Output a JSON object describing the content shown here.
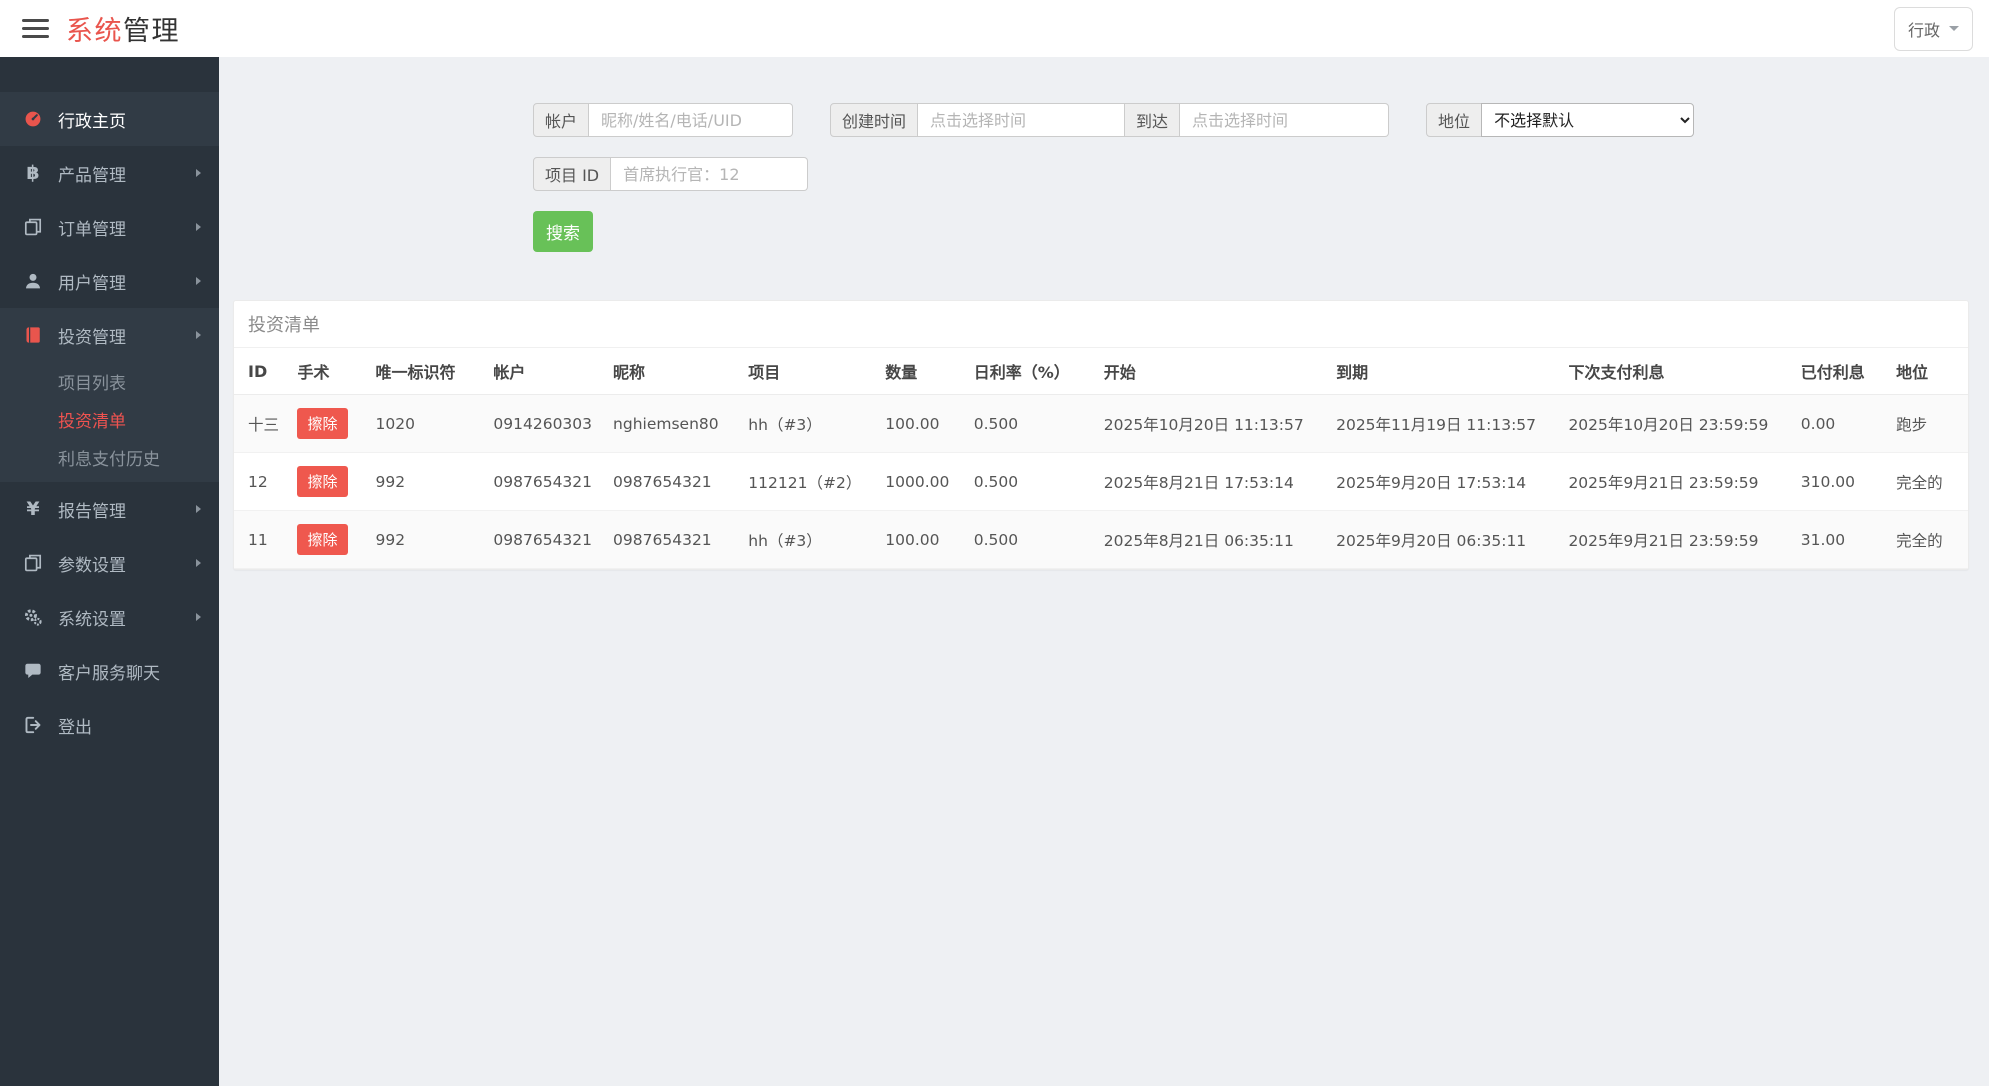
{
  "header": {
    "brand_red": "系统",
    "brand_dark": "管理",
    "user_menu_label": "行政"
  },
  "sidebar": {
    "items": [
      {
        "name": "admin-home",
        "label": "行政主页",
        "icon": "dashboard-icon",
        "icon_accent": true,
        "active": true
      },
      {
        "name": "product-management",
        "label": "产品管理",
        "icon": "bitcoin-icon",
        "chevron": true
      },
      {
        "name": "order-management",
        "label": "订单管理",
        "icon": "orders-icon",
        "chevron": true
      },
      {
        "name": "user-management",
        "label": "用户管理",
        "icon": "users-icon",
        "chevron": true
      },
      {
        "name": "investment-management",
        "label": "投资管理",
        "icon": "book-icon",
        "icon_accent": true,
        "chevron": true,
        "expanded": true,
        "children": [
          {
            "name": "project-list",
            "label": "项目列表"
          },
          {
            "name": "investment-list",
            "label": "投资清单",
            "active": true
          },
          {
            "name": "interest-payment-history",
            "label": "利息支付历史"
          }
        ]
      },
      {
        "name": "report-management",
        "label": "报告管理",
        "icon": "yen-icon",
        "chevron": true
      },
      {
        "name": "parameter-settings",
        "label": "参数设置",
        "icon": "params-icon",
        "chevron": true
      },
      {
        "name": "system-settings",
        "label": "系统设置",
        "icon": "gears-icon",
        "chevron": true
      },
      {
        "name": "customer-service-chat",
        "label": "客户服务聊天",
        "icon": "chat-icon"
      },
      {
        "name": "logout",
        "label": "登出",
        "icon": "logout-icon"
      }
    ]
  },
  "filters": {
    "account_label": "帐户",
    "account_placeholder": "昵称/姓名/电话/UID",
    "created_label": "创建时间",
    "created_placeholder": "点击选择时间",
    "until_label": "到达",
    "until_placeholder": "点击选择时间",
    "status_label": "地位",
    "status_value": "不选择默认",
    "project_label": "项目 ID",
    "project_placeholder": "首席执行官：12",
    "search_button": "搜索"
  },
  "table": {
    "title": "投资清单",
    "delete_label": "擦除",
    "columns": [
      "ID",
      "手术",
      "唯一标识符",
      "帐户",
      "昵称",
      "项目",
      "数量",
      "日利率（%）",
      "开始",
      "到期",
      "下次支付利息",
      "已付利息",
      "地位"
    ],
    "rows": [
      {
        "id": "十三",
        "uid": "1020",
        "account": "0914260303",
        "nickname": "nghiemsen80",
        "project": "hh（#3）",
        "amount": "100.00",
        "rate": "0.500",
        "start": "2025年10月20日 11:13:57",
        "expire": "2025年11月19日 11:13:57",
        "next_pay": "2025年10月20日 23:59:59",
        "paid": "0.00",
        "status": "跑步"
      },
      {
        "id": "12",
        "uid": "992",
        "account": "0987654321",
        "nickname": "0987654321",
        "project": "112121（#2）",
        "amount": "1000.00",
        "rate": "0.500",
        "start": "2025年8月21日 17:53:14",
        "expire": "2025年9月20日 17:53:14",
        "next_pay": "2025年9月21日 23:59:59",
        "paid": "310.00",
        "status": "完全的"
      },
      {
        "id": "11",
        "uid": "992",
        "account": "0987654321",
        "nickname": "0987654321",
        "project": "hh（#3）",
        "amount": "100.00",
        "rate": "0.500",
        "start": "2025年8月21日 06:35:11",
        "expire": "2025年9月20日 06:35:11",
        "next_pay": "2025年9月21日 23:59:59",
        "paid": "31.00",
        "status": "完全的"
      }
    ]
  },
  "colors": {
    "brand_red": "#e9554d",
    "search_green": "#68c158",
    "delete_red": "#ef584e",
    "sidebar_bg": "#2a333c",
    "active_link_red": "#ef5350"
  }
}
